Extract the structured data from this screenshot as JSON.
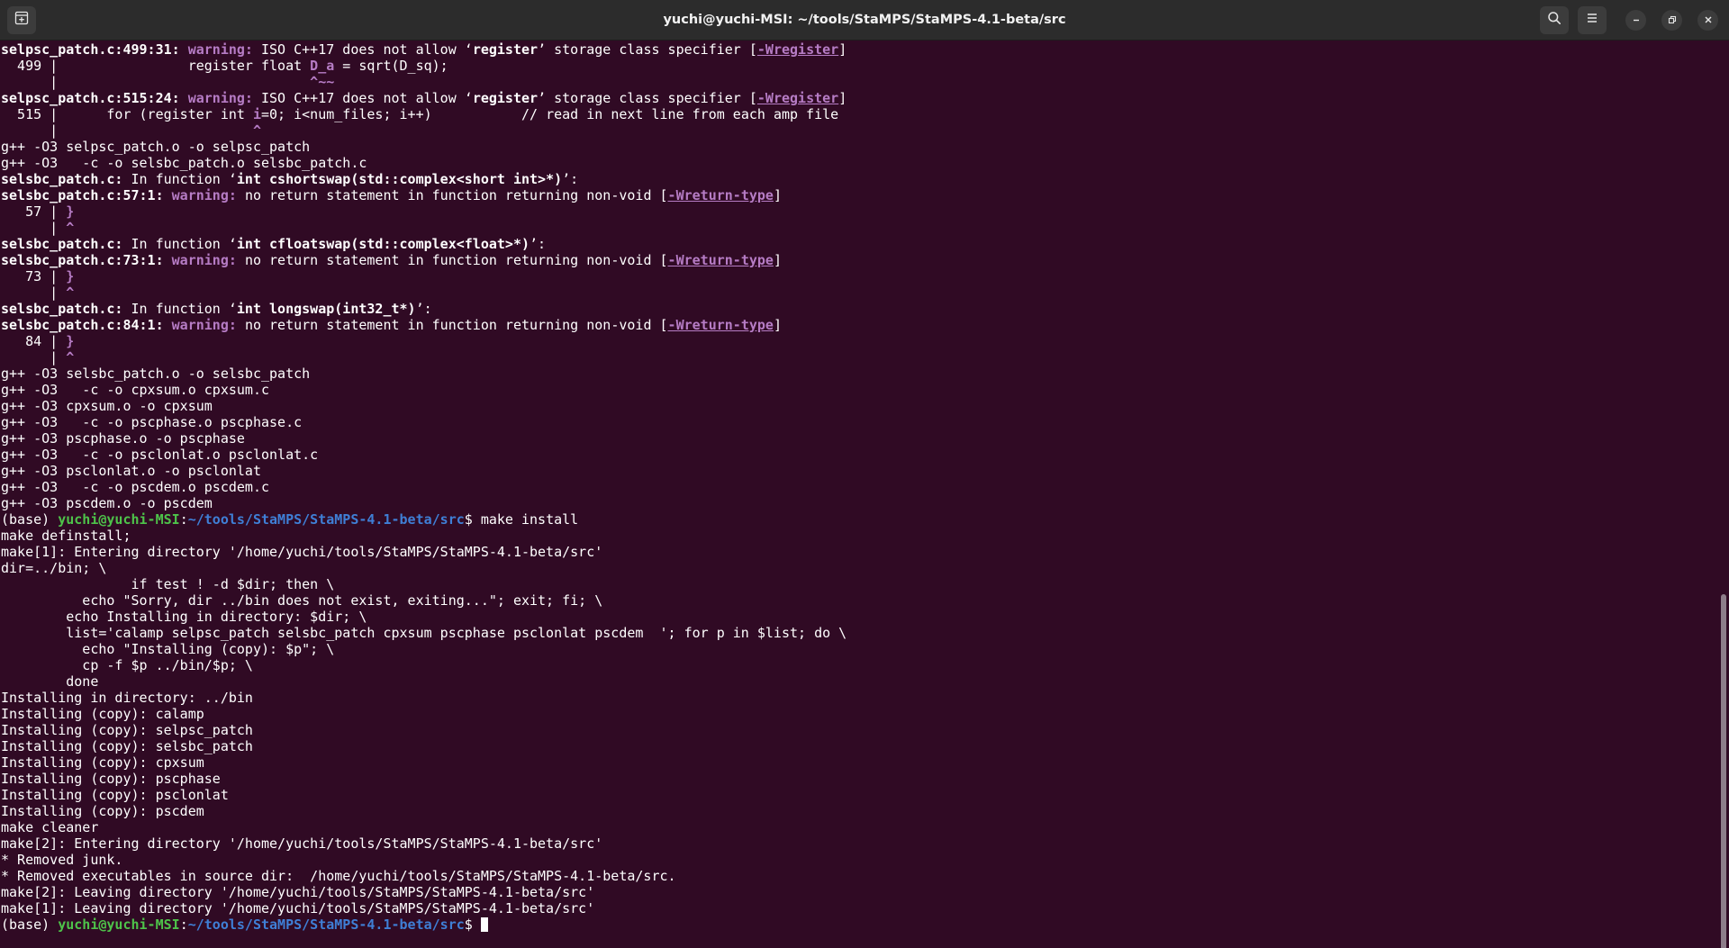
{
  "window": {
    "title": "yuchi@yuchi-MSI: ~/tools/StaMPS/StaMPS-4.1-beta/src"
  },
  "titlebar": {
    "icons": [
      "new-tab-icon",
      "search-icon",
      "hamburger-menu-icon",
      "minimize-icon",
      "maximize-icon",
      "close-icon"
    ]
  },
  "colors": {
    "background": "#300a24",
    "warning": "#b67cc5",
    "user": "#4ec34a",
    "path": "#3f7fd6",
    "text": "#ffffff"
  },
  "terminal": {
    "lines": [
      [
        {
          "t": "selpsc_patch.c:499:31: ",
          "c": "b"
        },
        {
          "t": "warning: ",
          "c": "warn"
        },
        {
          "t": "ISO C++17 does not allow ‘"
        },
        {
          "t": "register",
          "c": "b"
        },
        {
          "t": "’ storage class specifier ["
        },
        {
          "t": "-Wregister",
          "c": "warn ul"
        },
        {
          "t": "]"
        }
      ],
      [
        {
          "t": "  499 |                register float "
        },
        {
          "t": "D_a",
          "c": "caret"
        },
        {
          "t": " = sqrt(D_sq);"
        }
      ],
      [
        {
          "t": "      |                               "
        },
        {
          "t": "^~~",
          "c": "caret"
        }
      ],
      [
        {
          "t": "selpsc_patch.c:515:24: ",
          "c": "b"
        },
        {
          "t": "warning: ",
          "c": "warn"
        },
        {
          "t": "ISO C++17 does not allow ‘"
        },
        {
          "t": "register",
          "c": "b"
        },
        {
          "t": "’ storage class specifier ["
        },
        {
          "t": "-Wregister",
          "c": "warn ul"
        },
        {
          "t": "]"
        }
      ],
      [
        {
          "t": "  515 |      for (register int "
        },
        {
          "t": "i",
          "c": "caret"
        },
        {
          "t": "=0; i<num_files; i++)           // read in next line from each amp file"
        }
      ],
      [
        {
          "t": "      |                        "
        },
        {
          "t": "^",
          "c": "caret"
        }
      ],
      [
        {
          "t": "g++ -O3 selpsc_patch.o -o selpsc_patch"
        }
      ],
      [
        {
          "t": "g++ -O3   -c -o selsbc_patch.o selsbc_patch.c"
        }
      ],
      [
        {
          "t": "selsbc_patch.c:",
          "c": "b"
        },
        {
          "t": " In function ‘"
        },
        {
          "t": "int cshortswap(std::complex<short int>*)",
          "c": "b"
        },
        {
          "t": "’:"
        }
      ],
      [
        {
          "t": "selsbc_patch.c:57:1: ",
          "c": "b"
        },
        {
          "t": "warning: ",
          "c": "warn"
        },
        {
          "t": "no return statement in function returning non-void ["
        },
        {
          "t": "-Wreturn-type",
          "c": "warn ul"
        },
        {
          "t": "]"
        }
      ],
      [
        {
          "t": "   57 | "
        },
        {
          "t": "}",
          "c": "caret"
        }
      ],
      [
        {
          "t": "      | "
        },
        {
          "t": "^",
          "c": "caret"
        }
      ],
      [
        {
          "t": "selsbc_patch.c:",
          "c": "b"
        },
        {
          "t": " In function ‘"
        },
        {
          "t": "int cfloatswap(std::complex<float>*)",
          "c": "b"
        },
        {
          "t": "’:"
        }
      ],
      [
        {
          "t": "selsbc_patch.c:73:1: ",
          "c": "b"
        },
        {
          "t": "warning: ",
          "c": "warn"
        },
        {
          "t": "no return statement in function returning non-void ["
        },
        {
          "t": "-Wreturn-type",
          "c": "warn ul"
        },
        {
          "t": "]"
        }
      ],
      [
        {
          "t": "   73 | "
        },
        {
          "t": "}",
          "c": "caret"
        }
      ],
      [
        {
          "t": "      | "
        },
        {
          "t": "^",
          "c": "caret"
        }
      ],
      [
        {
          "t": "selsbc_patch.c:",
          "c": "b"
        },
        {
          "t": " In function ‘"
        },
        {
          "t": "int longswap(int32_t*)",
          "c": "b"
        },
        {
          "t": "’:"
        }
      ],
      [
        {
          "t": "selsbc_patch.c:84:1: ",
          "c": "b"
        },
        {
          "t": "warning: ",
          "c": "warn"
        },
        {
          "t": "no return statement in function returning non-void ["
        },
        {
          "t": "-Wreturn-type",
          "c": "warn ul"
        },
        {
          "t": "]"
        }
      ],
      [
        {
          "t": "   84 | "
        },
        {
          "t": "}",
          "c": "caret"
        }
      ],
      [
        {
          "t": "      | "
        },
        {
          "t": "^",
          "c": "caret"
        }
      ],
      [
        {
          "t": "g++ -O3 selsbc_patch.o -o selsbc_patch"
        }
      ],
      [
        {
          "t": "g++ -O3   -c -o cpxsum.o cpxsum.c"
        }
      ],
      [
        {
          "t": "g++ -O3 cpxsum.o -o cpxsum"
        }
      ],
      [
        {
          "t": "g++ -O3   -c -o pscphase.o pscphase.c"
        }
      ],
      [
        {
          "t": "g++ -O3 pscphase.o -o pscphase"
        }
      ],
      [
        {
          "t": "g++ -O3   -c -o psclonlat.o psclonlat.c"
        }
      ],
      [
        {
          "t": "g++ -O3 psclonlat.o -o psclonlat"
        }
      ],
      [
        {
          "t": "g++ -O3   -c -o pscdem.o pscdem.c"
        }
      ],
      [
        {
          "t": "g++ -O3 pscdem.o -o pscdem"
        }
      ],
      [
        {
          "t": "(base) "
        },
        {
          "t": "yuchi@yuchi-MSI",
          "c": "user"
        },
        {
          "t": ":"
        },
        {
          "t": "~/tools/StaMPS/StaMPS-4.1-beta/src",
          "c": "path"
        },
        {
          "t": "$ make install"
        }
      ],
      [
        {
          "t": "make definstall;"
        }
      ],
      [
        {
          "t": "make[1]: Entering directory '/home/yuchi/tools/StaMPS/StaMPS-4.1-beta/src'"
        }
      ],
      [
        {
          "t": "dir=../bin; \\"
        }
      ],
      [
        {
          "t": "                if test ! -d $dir; then \\"
        }
      ],
      [
        {
          "t": "          echo \"Sorry, dir ../bin does not exist, exiting...\"; exit; fi; \\"
        }
      ],
      [
        {
          "t": "        echo Installing in directory: $dir; \\"
        }
      ],
      [
        {
          "t": "        list='calamp selpsc_patch selsbc_patch cpxsum pscphase psclonlat pscdem  '; for p in $list; do \\"
        }
      ],
      [
        {
          "t": "          echo \"Installing (copy): $p\"; \\"
        }
      ],
      [
        {
          "t": "          cp -f $p ../bin/$p; \\"
        }
      ],
      [
        {
          "t": "        done"
        }
      ],
      [
        {
          "t": "Installing in directory: ../bin"
        }
      ],
      [
        {
          "t": "Installing (copy): calamp"
        }
      ],
      [
        {
          "t": "Installing (copy): selpsc_patch"
        }
      ],
      [
        {
          "t": "Installing (copy): selsbc_patch"
        }
      ],
      [
        {
          "t": "Installing (copy): cpxsum"
        }
      ],
      [
        {
          "t": "Installing (copy): pscphase"
        }
      ],
      [
        {
          "t": "Installing (copy): psclonlat"
        }
      ],
      [
        {
          "t": "Installing (copy): pscdem"
        }
      ],
      [
        {
          "t": "make cleaner"
        }
      ],
      [
        {
          "t": "make[2]: Entering directory '/home/yuchi/tools/StaMPS/StaMPS-4.1-beta/src'"
        }
      ],
      [
        {
          "t": "* Removed junk."
        }
      ],
      [
        {
          "t": "* Removed executables in source dir:  /home/yuchi/tools/StaMPS/StaMPS-4.1-beta/src."
        }
      ],
      [
        {
          "t": "make[2]: Leaving directory '/home/yuchi/tools/StaMPS/StaMPS-4.1-beta/src'"
        }
      ],
      [
        {
          "t": "make[1]: Leaving directory '/home/yuchi/tools/StaMPS/StaMPS-4.1-beta/src'"
        }
      ],
      [
        {
          "t": "(base) "
        },
        {
          "t": "yuchi@yuchi-MSI",
          "c": "user"
        },
        {
          "t": ":"
        },
        {
          "t": "~/tools/StaMPS/StaMPS-4.1-beta/src",
          "c": "path"
        },
        {
          "t": "$ "
        }
      ]
    ]
  }
}
